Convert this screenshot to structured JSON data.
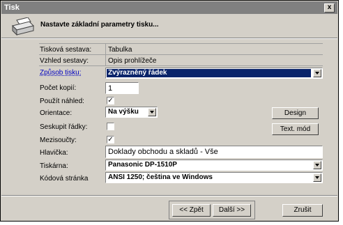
{
  "window": {
    "title": "Tisk",
    "close_glyph": "x"
  },
  "header": {
    "title": "Nastavte základní parametry tisku...",
    "icon": "printer-icon"
  },
  "fields": {
    "report_label": "Tisková sestava:",
    "report_value": "Tabulka",
    "view_label": "Vzhled sestavy:",
    "view_value": "Opis prohlížeče",
    "mode_label": "Způsob tisku:",
    "mode_value": "Zvýrazněný řádek",
    "copies_label": "Počet kopií:",
    "copies_value": "1",
    "preview_label": "Použít náhled:",
    "preview_checked": "✓",
    "orientation_label": "Orientace:",
    "orientation_value": "Na výšku",
    "group_label": "Seskupit řádky:",
    "group_checked": "",
    "subtotals_label": "Mezisoučty:",
    "subtotals_checked": "✓",
    "header_label": "Hlavička:",
    "header_value": "Doklady obchodu a skladů - Vše",
    "printer_label": "Tiskárna:",
    "printer_value": "Panasonic DP-1510P",
    "codepage_label": "Kódová stránka",
    "codepage_value": "ANSI 1250; čeština ve Windows"
  },
  "buttons": {
    "design": "Design",
    "text_mode": "Text. mód",
    "back": "<< Zpět",
    "next": "Další >>",
    "cancel": "Zrušit"
  }
}
